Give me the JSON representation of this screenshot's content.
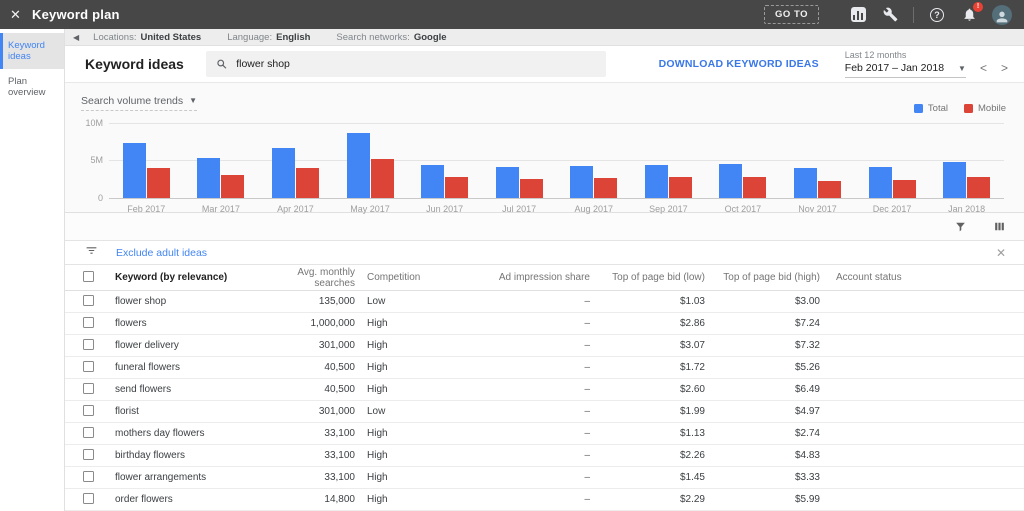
{
  "topbar": {
    "title": "Keyword plan",
    "go_to_label": "GO TO",
    "notification_badge": "!",
    "help_glyph": "?"
  },
  "sidebar": {
    "items": [
      {
        "label": "Keyword ideas"
      },
      {
        "label": "Plan overview"
      }
    ]
  },
  "context_bar": {
    "locations_label": "Locations:",
    "locations_value": "United States",
    "language_label": "Language:",
    "language_value": "English",
    "networks_label": "Search networks:",
    "networks_value": "Google"
  },
  "header": {
    "title": "Keyword ideas",
    "search_value": "flower shop",
    "download_label": "DOWNLOAD KEYWORD IDEAS",
    "date_caption": "Last 12 months",
    "date_value": "Feb 2017 – Jan 2018"
  },
  "chart": {
    "selector_label": "Search volume trends"
  },
  "chart_data": {
    "type": "bar",
    "title": "Search volume trends",
    "categories": [
      "Feb 2017",
      "Mar 2017",
      "Apr 2017",
      "May 2017",
      "Jun 2017",
      "Jul 2017",
      "Aug 2017",
      "Sep 2017",
      "Oct 2017",
      "Nov 2017",
      "Dec 2017",
      "Jan 2018"
    ],
    "series": [
      {
        "name": "Total",
        "color": "#4285f4",
        "values": [
          7.3,
          5.3,
          6.6,
          8.5,
          4.4,
          4.1,
          4.2,
          4.4,
          4.5,
          3.9,
          4.1,
          4.8
        ]
      },
      {
        "name": "Mobile",
        "color": "#db4437",
        "values": [
          4.0,
          3.0,
          3.9,
          5.1,
          2.7,
          2.5,
          2.6,
          2.7,
          2.7,
          2.3,
          2.4,
          2.8
        ]
      }
    ],
    "value_unit": "millions of searches",
    "ylim": [
      0,
      10
    ],
    "ytick_labels": [
      "10M",
      "5M",
      "0"
    ],
    "legend_position": "top-right",
    "grid": true
  },
  "filter_bar": {
    "filter_label": "Exclude adult ideas"
  },
  "table": {
    "columns": [
      "Keyword (by relevance)",
      "Avg. monthly searches",
      "Competition",
      "Ad impression share",
      "Top of page bid (low)",
      "Top of page bid (high)",
      "Account status"
    ],
    "rows": [
      {
        "keyword": "flower shop",
        "searches": "135,000",
        "competition": "Low",
        "ad_share": "–",
        "bid_low": "$1.03",
        "bid_high": "$3.00",
        "account_status": ""
      },
      {
        "keyword": "flowers",
        "searches": "1,000,000",
        "competition": "High",
        "ad_share": "–",
        "bid_low": "$2.86",
        "bid_high": "$7.24",
        "account_status": ""
      },
      {
        "keyword": "flower delivery",
        "searches": "301,000",
        "competition": "High",
        "ad_share": "–",
        "bid_low": "$3.07",
        "bid_high": "$7.32",
        "account_status": ""
      },
      {
        "keyword": "funeral flowers",
        "searches": "40,500",
        "competition": "High",
        "ad_share": "–",
        "bid_low": "$1.72",
        "bid_high": "$5.26",
        "account_status": ""
      },
      {
        "keyword": "send flowers",
        "searches": "40,500",
        "competition": "High",
        "ad_share": "–",
        "bid_low": "$2.60",
        "bid_high": "$6.49",
        "account_status": ""
      },
      {
        "keyword": "florist",
        "searches": "301,000",
        "competition": "Low",
        "ad_share": "–",
        "bid_low": "$1.99",
        "bid_high": "$4.97",
        "account_status": ""
      },
      {
        "keyword": "mothers day flowers",
        "searches": "33,100",
        "competition": "High",
        "ad_share": "–",
        "bid_low": "$1.13",
        "bid_high": "$2.74",
        "account_status": ""
      },
      {
        "keyword": "birthday flowers",
        "searches": "33,100",
        "competition": "High",
        "ad_share": "–",
        "bid_low": "$2.26",
        "bid_high": "$4.83",
        "account_status": ""
      },
      {
        "keyword": "flower arrangements",
        "searches": "33,100",
        "competition": "High",
        "ad_share": "–",
        "bid_low": "$1.45",
        "bid_high": "$3.33",
        "account_status": ""
      },
      {
        "keyword": "order flowers",
        "searches": "14,800",
        "competition": "High",
        "ad_share": "–",
        "bid_low": "$2.29",
        "bid_high": "$5.99",
        "account_status": ""
      }
    ]
  }
}
